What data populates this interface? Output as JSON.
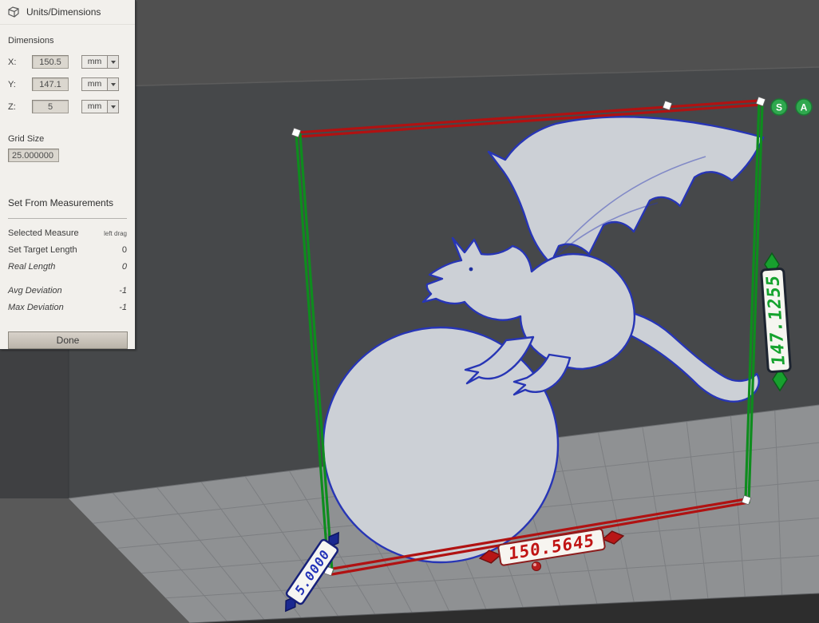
{
  "panel": {
    "title": "Units/Dimensions",
    "dimensions": {
      "section_label": "Dimensions",
      "rows": [
        {
          "axis": "X:",
          "value": "150.5",
          "unit": "mm"
        },
        {
          "axis": "Y:",
          "value": "147.1",
          "unit": "mm"
        },
        {
          "axis": "Z:",
          "value": "5",
          "unit": "mm"
        }
      ]
    },
    "grid": {
      "label": "Grid Size",
      "value": "25.000000"
    },
    "measure_section": {
      "title": "Set From Measurements",
      "rows": [
        {
          "label": "Selected Measure",
          "value": "left drag"
        },
        {
          "label": "Set Target Length",
          "value": "0"
        },
        {
          "label": "Real Length",
          "value": "0"
        },
        {
          "label": "Avg Deviation",
          "value": "-1"
        },
        {
          "label": "Max Deviation",
          "value": "-1"
        }
      ]
    },
    "done_label": "Done"
  },
  "viewport": {
    "badges": [
      {
        "label": "S"
      },
      {
        "label": "A"
      }
    ],
    "labels": {
      "height": "147.1255",
      "width": "150.5645",
      "depth": "5.0000"
    },
    "colors": {
      "width_line": "#b01212",
      "height_line": "#0e8c1e",
      "height_text": "#15a32e",
      "width_text": "#c01414",
      "depth_text": "#2333b8",
      "badge_fill": "#2fa84e"
    }
  }
}
